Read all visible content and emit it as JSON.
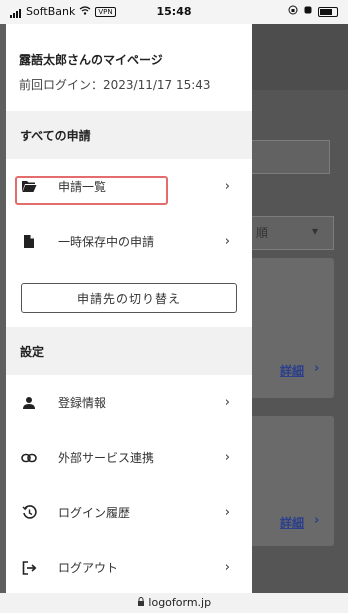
{
  "status_bar": {
    "carrier": "SoftBank",
    "vpn": "VPN",
    "time": "15:48"
  },
  "drawer": {
    "user_name": "露語太郎さんのマイページ",
    "last_login": "前回ログイン：2023/11/17 15:43",
    "section_all": "すべての申請",
    "items_all": [
      {
        "label": "申請一覧",
        "icon": "folder-open-icon"
      },
      {
        "label": "一時保存中の申請",
        "icon": "file-icon"
      }
    ],
    "switch_button": "申請先の切り替え",
    "section_settings": "設定",
    "items_settings": [
      {
        "label": "登録情報",
        "icon": "user-icon"
      },
      {
        "label": "外部サービス連携",
        "icon": "link-icon"
      },
      {
        "label": "ログイン履歴",
        "icon": "history-icon"
      },
      {
        "label": "ログアウト",
        "icon": "logout-icon"
      }
    ]
  },
  "background": {
    "select_suffix": "順",
    "detail_link": "詳細"
  },
  "browser": {
    "url": "logoform.jp"
  },
  "colors": {
    "highlight": "#e36c6c",
    "overlay": "#5f5f5f"
  }
}
